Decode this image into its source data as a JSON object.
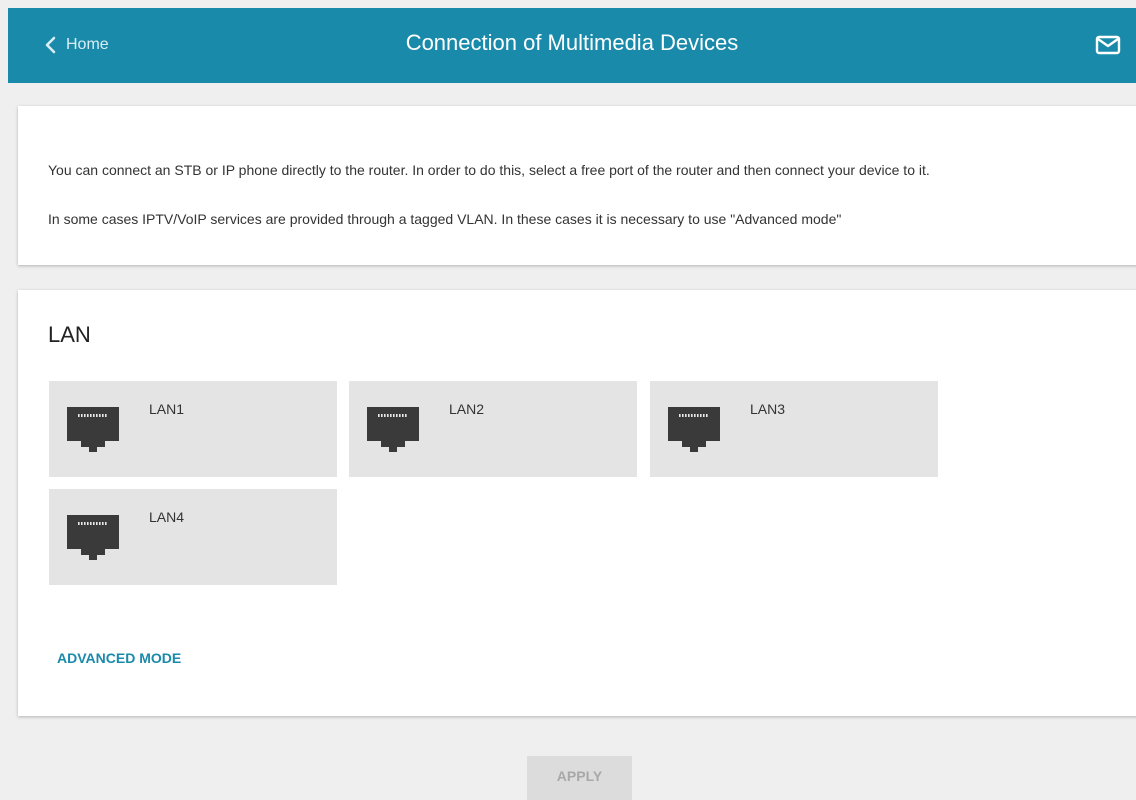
{
  "header": {
    "back_label": "Home",
    "title": "Connection of Multimedia Devices",
    "back_icon": "chevron-left-icon",
    "mail_icon": "envelope-icon",
    "color": "#1a8aab"
  },
  "info": {
    "line1": "You can connect an STB or IP phone directly to the router. In order to do this, select a free port of the router and then connect your device to it.",
    "line2": "In some cases IPTV/VoIP services are provided through a tagged VLAN. In these cases it is necessary to use \"Advanced mode\""
  },
  "lan": {
    "title": "LAN",
    "port_icon": "ethernet-port-icon",
    "ports": [
      {
        "label": "LAN1"
      },
      {
        "label": "LAN2"
      },
      {
        "label": "LAN3"
      },
      {
        "label": "LAN4"
      }
    ],
    "advanced_label": "ADVANCED MODE"
  },
  "actions": {
    "apply_label": "APPLY"
  }
}
